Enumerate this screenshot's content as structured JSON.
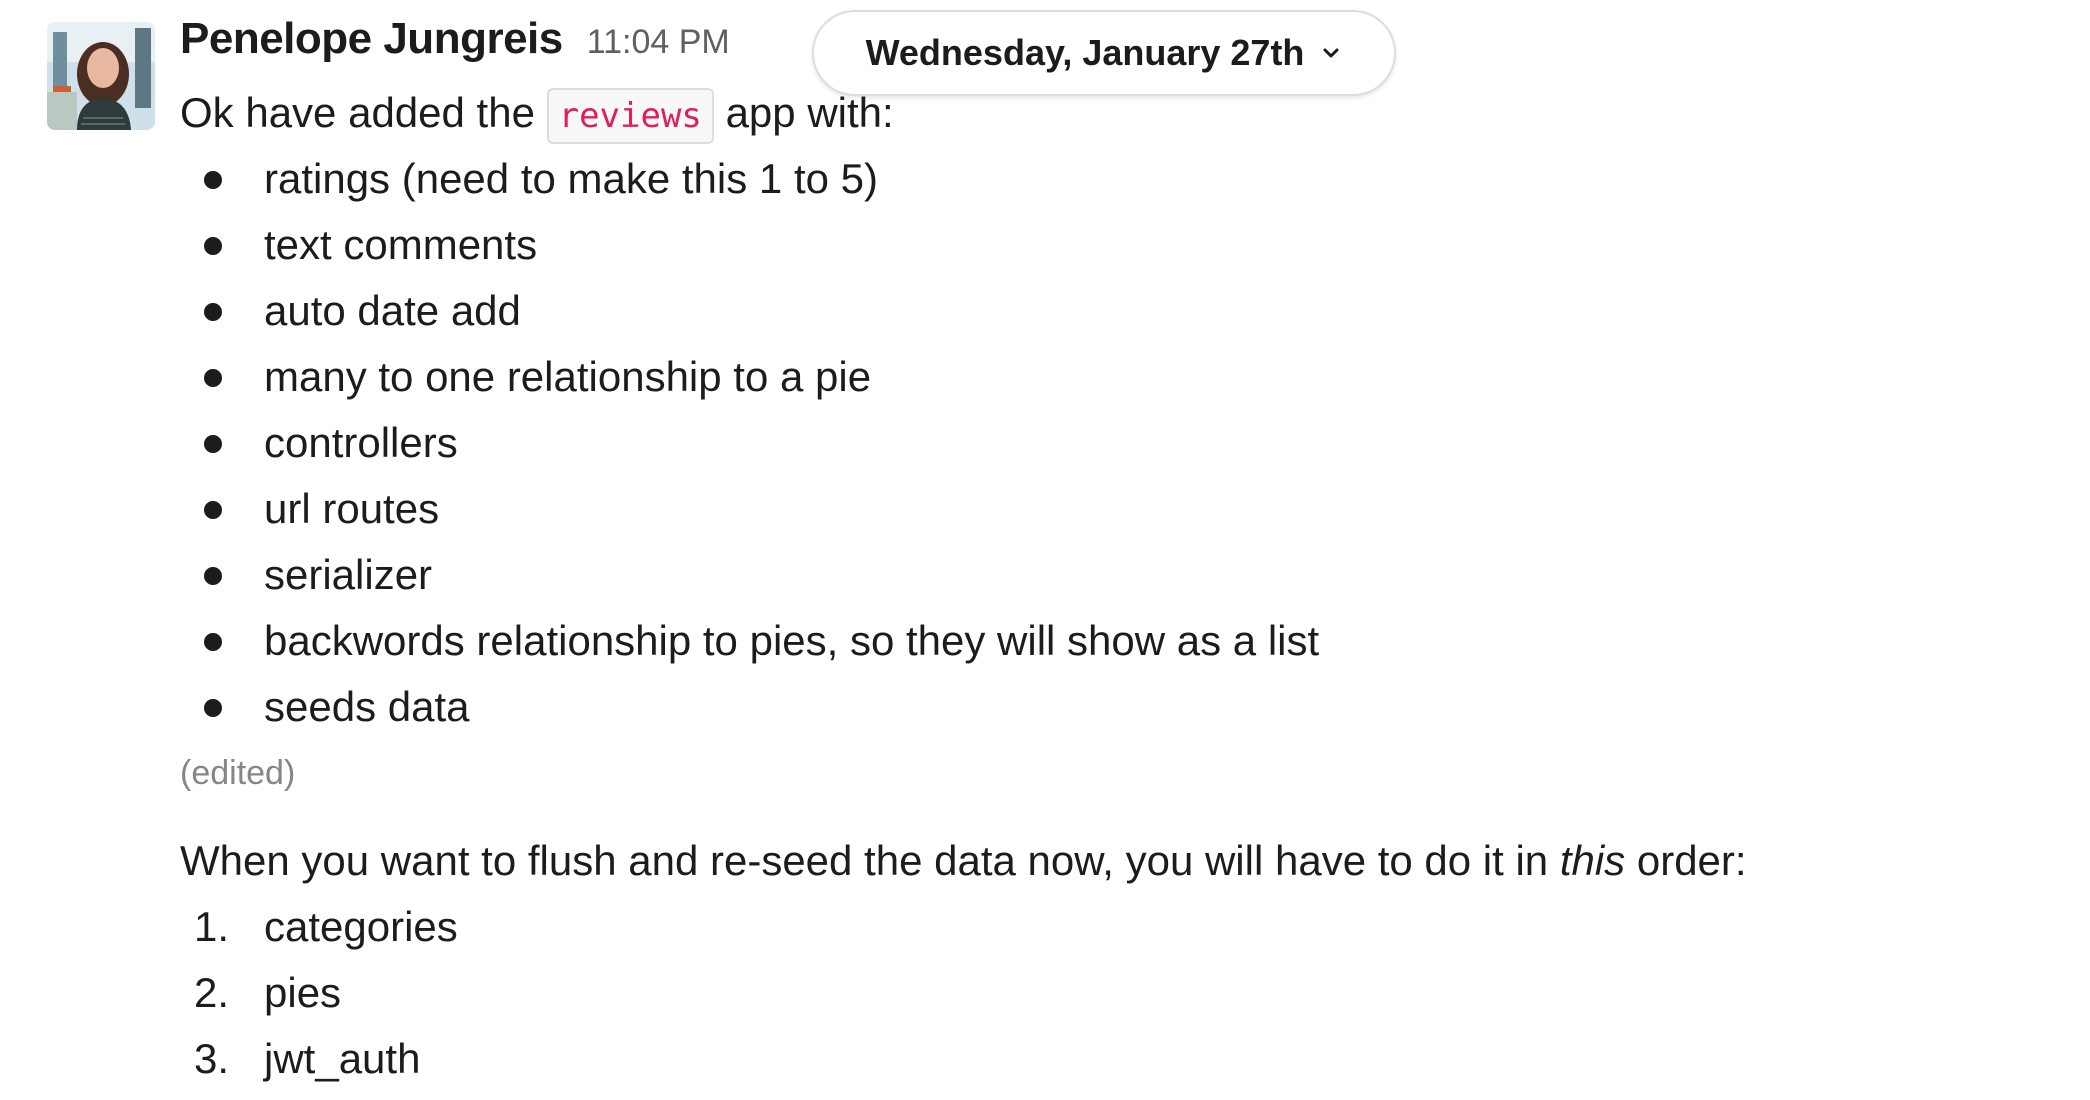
{
  "message": {
    "sender": "Penelope Jungreis",
    "time": "11:04 PM",
    "date_divider": "Wednesday, January 27th",
    "intro_before_code": "Ok have added the ",
    "intro_code": "reviews",
    "intro_after_code": " app with:",
    "bullets": [
      "ratings (need to make this 1 to 5)",
      "text comments",
      "auto date add",
      "many to one relationship to a pie",
      "controllers",
      "url routes",
      "serializer",
      "backwords relationship to pies, so they will show as a list",
      "seeds data"
    ],
    "edited_label": "(edited)",
    "second_before": "When you want to flush and re-seed the data now, you will have to do it in ",
    "second_emphasis": "this",
    "second_after": " order:",
    "ordered": [
      {
        "num": "1.",
        "text": "categories"
      },
      {
        "num": "2.",
        "text": "pies"
      },
      {
        "num": "3.",
        "text": "jwt_auth"
      }
    ]
  }
}
